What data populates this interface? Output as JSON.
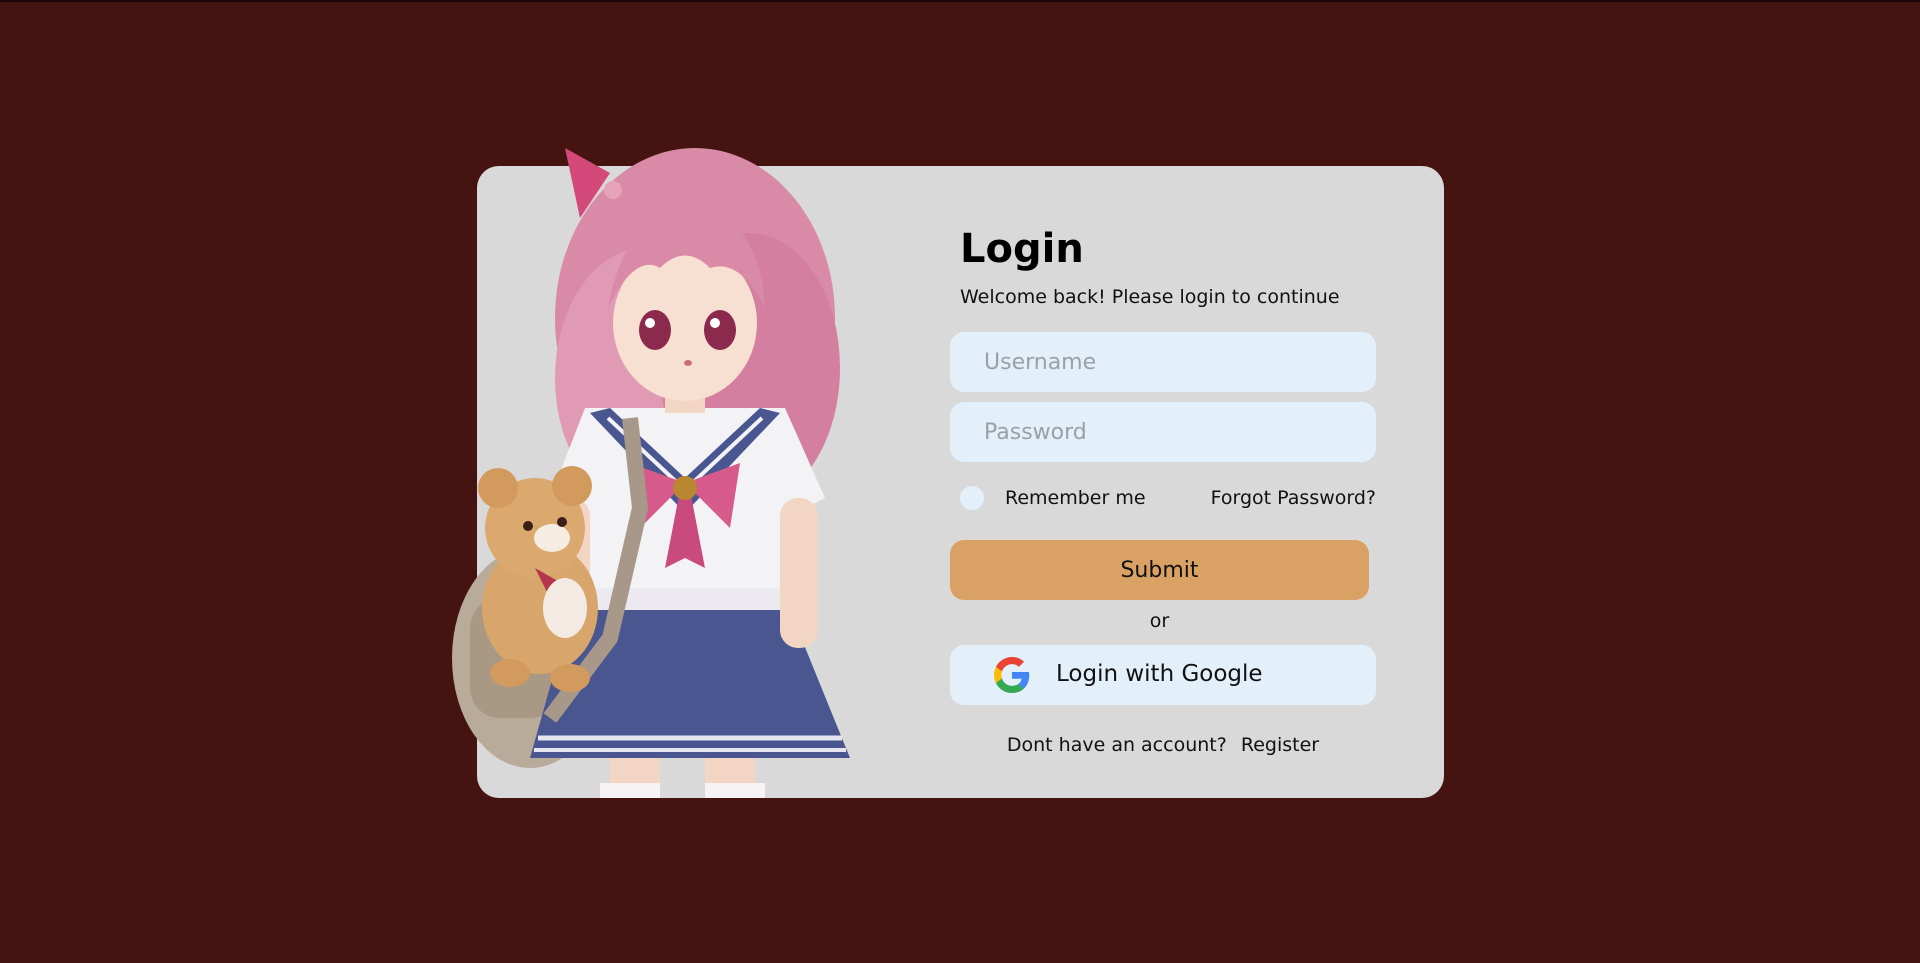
{
  "login": {
    "title": "Login",
    "subtitle": "Welcome back! Please login to continue",
    "username_placeholder": "Username",
    "password_placeholder": "Password",
    "remember_label": "Remember me",
    "forgot_label": "Forgot Password?",
    "submit_label": "Submit",
    "or_text": "or",
    "google_label": "Login with Google",
    "register_prompt": "Dont have an account?",
    "register_label": "Register"
  },
  "illustration": {
    "subject": "anime-girl-with-teddy-bear"
  },
  "icons": {
    "google": "google-g-icon"
  },
  "colors": {
    "background": "#461410",
    "card": "#d9d9d9",
    "input": "#e3f0fa",
    "submit": "#d9a164"
  }
}
